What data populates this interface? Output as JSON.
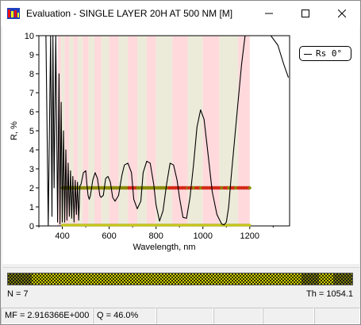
{
  "window": {
    "title": "Evaluation - SINGLE LAYER 20H AT 500 NM [M]",
    "controls": {
      "minimize": "—",
      "maximize": "☐",
      "close": "✕"
    }
  },
  "legend": {
    "label": "Rs  0°"
  },
  "footer": {
    "n_label": "N = 7",
    "th_label": "Th = 1054.1"
  },
  "status": {
    "mf": "MF =  2.916366E+000",
    "q": "Q = 46.0%"
  },
  "colors": {
    "band_pink": "#ffd9dc",
    "band_beige": "#ecebda",
    "marker_olive": "#8a8a00",
    "marker_red": "#d42a1a",
    "marker_yellow": "#d8d800"
  },
  "chart_data": {
    "type": "line",
    "xlabel": "Wavelength, nm",
    "ylabel": "R, %",
    "xlim": [
      300,
      1370
    ],
    "ylim": [
      0,
      10
    ],
    "xticks": [
      "400",
      "600",
      "800",
      "1000",
      "1200"
    ],
    "yticks": [
      "0",
      "1",
      "2",
      "3",
      "4",
      "5",
      "6",
      "7",
      "8",
      "9",
      "10"
    ],
    "series": [
      {
        "name": "Rs 0°",
        "x": [
          330,
          340,
          350,
          356,
          360,
          365,
          372,
          380,
          386,
          390,
          395,
          400,
          405,
          410,
          415,
          420,
          425,
          430,
          435,
          440,
          445,
          450,
          455,
          460,
          465,
          470,
          475,
          480,
          490,
          500,
          505,
          510,
          515,
          520,
          530,
          540,
          550,
          560,
          565,
          575,
          585,
          595,
          605,
          615,
          625,
          640,
          655,
          665,
          680,
          695,
          705,
          720,
          735,
          745,
          760,
          775,
          790,
          800,
          815,
          830,
          845,
          860,
          875,
          890,
          900,
          915,
          930,
          945,
          960,
          975,
          990,
          1005,
          1020,
          1040,
          1060,
          1080,
          1090,
          1100,
          1110,
          1120,
          1135,
          1150,
          1165,
          1180,
          1195,
          1210,
          1230,
          1260,
          1290,
          1320,
          1345,
          1365
        ],
        "y": [
          10,
          0,
          10,
          0.5,
          10,
          2,
          10,
          0.2,
          8,
          0.1,
          6.5,
          0.2,
          5,
          0.2,
          4,
          0.3,
          3.3,
          0.5,
          2.9,
          0.4,
          2.6,
          0.2,
          2.4,
          0.6,
          2.3,
          0.3,
          2.1,
          2.2,
          2.8,
          2.9,
          2.2,
          1.6,
          1.4,
          1.6,
          2.4,
          2.8,
          2.5,
          1.6,
          1.5,
          1.6,
          2.5,
          2.6,
          2.3,
          1.5,
          1.3,
          1.6,
          2.7,
          3.2,
          3.3,
          2.8,
          1.4,
          0.9,
          1.3,
          2.8,
          3.4,
          3.3,
          2.2,
          1.1,
          0.25,
          0.8,
          2.2,
          3.3,
          3.2,
          2.4,
          1.5,
          0.45,
          0.4,
          1.5,
          3.2,
          5.2,
          6.1,
          5.6,
          4.0,
          1.8,
          0.6,
          0.1,
          0.05,
          0.2,
          1.0,
          2.5,
          4.5,
          6.5,
          8.5,
          10,
          10,
          10,
          10,
          10,
          10,
          9.5,
          8.5,
          7.8
        ]
      }
    ],
    "bands": [
      {
        "from": 380,
        "to": 395,
        "color": "pink"
      },
      {
        "from": 395,
        "to": 410,
        "color": "beige"
      },
      {
        "from": 410,
        "to": 430,
        "color": "pink"
      },
      {
        "from": 430,
        "to": 447,
        "color": "beige"
      },
      {
        "from": 447,
        "to": 467,
        "color": "pink"
      },
      {
        "from": 467,
        "to": 487,
        "color": "beige"
      },
      {
        "from": 487,
        "to": 512,
        "color": "pink"
      },
      {
        "from": 512,
        "to": 537,
        "color": "beige"
      },
      {
        "from": 537,
        "to": 567,
        "color": "pink"
      },
      {
        "from": 567,
        "to": 600,
        "color": "beige"
      },
      {
        "from": 600,
        "to": 640,
        "color": "pink"
      },
      {
        "from": 640,
        "to": 680,
        "color": "beige"
      },
      {
        "from": 680,
        "to": 720,
        "color": "pink"
      },
      {
        "from": 720,
        "to": 760,
        "color": "beige"
      },
      {
        "from": 760,
        "to": 800,
        "color": "pink"
      },
      {
        "from": 800,
        "to": 870,
        "color": "beige"
      },
      {
        "from": 870,
        "to": 935,
        "color": "pink"
      },
      {
        "from": 935,
        "to": 1000,
        "color": "beige"
      },
      {
        "from": 1000,
        "to": 1070,
        "color": "pink"
      },
      {
        "from": 1070,
        "to": 1150,
        "color": "beige"
      },
      {
        "from": 1150,
        "to": 1200,
        "color": "pink"
      }
    ],
    "target_level": 2,
    "target_range": [
      400,
      1200
    ],
    "bottom_marker_level": 0
  }
}
